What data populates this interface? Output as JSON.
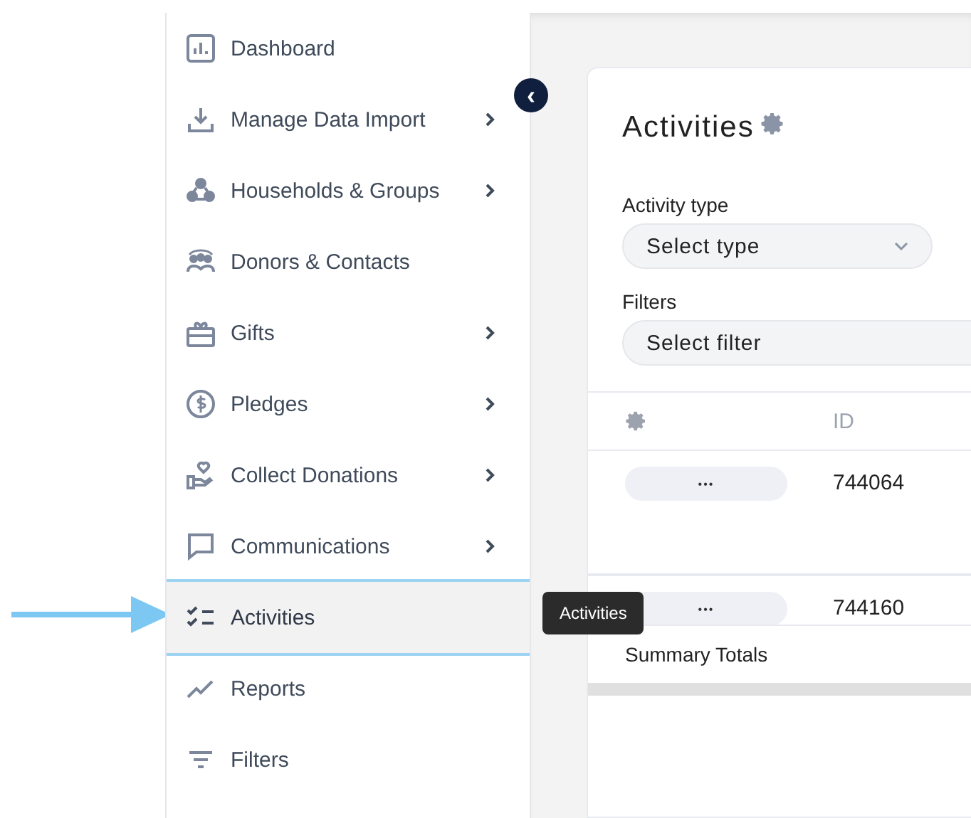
{
  "sidebar": {
    "items": [
      {
        "label": "Dashboard",
        "has_submenu": false,
        "selected": false
      },
      {
        "label": "Manage Data Import",
        "has_submenu": true,
        "selected": false
      },
      {
        "label": "Households & Groups",
        "has_submenu": true,
        "selected": false
      },
      {
        "label": "Donors & Contacts",
        "has_submenu": false,
        "selected": false
      },
      {
        "label": "Gifts",
        "has_submenu": true,
        "selected": false
      },
      {
        "label": "Pledges",
        "has_submenu": true,
        "selected": false
      },
      {
        "label": "Collect Donations",
        "has_submenu": true,
        "selected": false
      },
      {
        "label": "Communications",
        "has_submenu": true,
        "selected": false
      },
      {
        "label": "Activities",
        "has_submenu": false,
        "selected": true
      },
      {
        "label": "Reports",
        "has_submenu": false,
        "selected": false
      },
      {
        "label": "Filters",
        "has_submenu": false,
        "selected": false
      }
    ],
    "collapse_button": "‹"
  },
  "tooltip": "Activities",
  "page": {
    "title": "Activities",
    "activity_type": {
      "label": "Activity type",
      "placeholder": "Select type"
    },
    "filters": {
      "label": "Filters",
      "placeholder": "Select filter"
    },
    "table": {
      "columns": [
        "",
        "ID"
      ],
      "rows": [
        {
          "action": "•••",
          "id": "744064"
        },
        {
          "action": "•••",
          "id": "744160"
        }
      ],
      "summary": "Summary Totals"
    }
  }
}
